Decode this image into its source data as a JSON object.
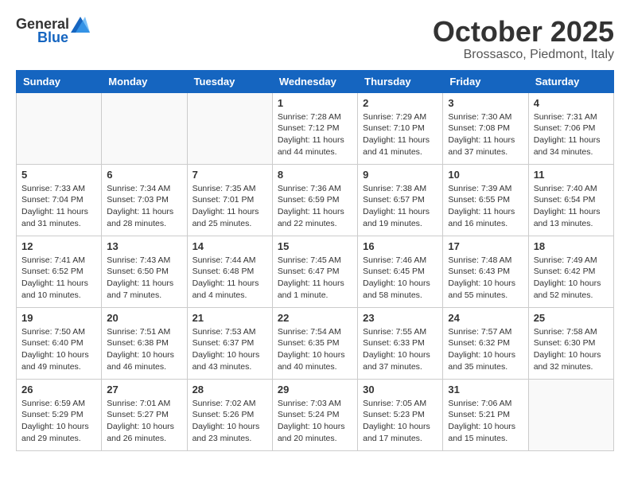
{
  "header": {
    "logo_general": "General",
    "logo_blue": "Blue",
    "month_title": "October 2025",
    "location": "Brossasco, Piedmont, Italy"
  },
  "weekdays": [
    "Sunday",
    "Monday",
    "Tuesday",
    "Wednesday",
    "Thursday",
    "Friday",
    "Saturday"
  ],
  "weeks": [
    [
      {
        "day": "",
        "info": ""
      },
      {
        "day": "",
        "info": ""
      },
      {
        "day": "",
        "info": ""
      },
      {
        "day": "1",
        "info": "Sunrise: 7:28 AM\nSunset: 7:12 PM\nDaylight: 11 hours and 44 minutes."
      },
      {
        "day": "2",
        "info": "Sunrise: 7:29 AM\nSunset: 7:10 PM\nDaylight: 11 hours and 41 minutes."
      },
      {
        "day": "3",
        "info": "Sunrise: 7:30 AM\nSunset: 7:08 PM\nDaylight: 11 hours and 37 minutes."
      },
      {
        "day": "4",
        "info": "Sunrise: 7:31 AM\nSunset: 7:06 PM\nDaylight: 11 hours and 34 minutes."
      }
    ],
    [
      {
        "day": "5",
        "info": "Sunrise: 7:33 AM\nSunset: 7:04 PM\nDaylight: 11 hours and 31 minutes."
      },
      {
        "day": "6",
        "info": "Sunrise: 7:34 AM\nSunset: 7:03 PM\nDaylight: 11 hours and 28 minutes."
      },
      {
        "day": "7",
        "info": "Sunrise: 7:35 AM\nSunset: 7:01 PM\nDaylight: 11 hours and 25 minutes."
      },
      {
        "day": "8",
        "info": "Sunrise: 7:36 AM\nSunset: 6:59 PM\nDaylight: 11 hours and 22 minutes."
      },
      {
        "day": "9",
        "info": "Sunrise: 7:38 AM\nSunset: 6:57 PM\nDaylight: 11 hours and 19 minutes."
      },
      {
        "day": "10",
        "info": "Sunrise: 7:39 AM\nSunset: 6:55 PM\nDaylight: 11 hours and 16 minutes."
      },
      {
        "day": "11",
        "info": "Sunrise: 7:40 AM\nSunset: 6:54 PM\nDaylight: 11 hours and 13 minutes."
      }
    ],
    [
      {
        "day": "12",
        "info": "Sunrise: 7:41 AM\nSunset: 6:52 PM\nDaylight: 11 hours and 10 minutes."
      },
      {
        "day": "13",
        "info": "Sunrise: 7:43 AM\nSunset: 6:50 PM\nDaylight: 11 hours and 7 minutes."
      },
      {
        "day": "14",
        "info": "Sunrise: 7:44 AM\nSunset: 6:48 PM\nDaylight: 11 hours and 4 minutes."
      },
      {
        "day": "15",
        "info": "Sunrise: 7:45 AM\nSunset: 6:47 PM\nDaylight: 11 hours and 1 minute."
      },
      {
        "day": "16",
        "info": "Sunrise: 7:46 AM\nSunset: 6:45 PM\nDaylight: 10 hours and 58 minutes."
      },
      {
        "day": "17",
        "info": "Sunrise: 7:48 AM\nSunset: 6:43 PM\nDaylight: 10 hours and 55 minutes."
      },
      {
        "day": "18",
        "info": "Sunrise: 7:49 AM\nSunset: 6:42 PM\nDaylight: 10 hours and 52 minutes."
      }
    ],
    [
      {
        "day": "19",
        "info": "Sunrise: 7:50 AM\nSunset: 6:40 PM\nDaylight: 10 hours and 49 minutes."
      },
      {
        "day": "20",
        "info": "Sunrise: 7:51 AM\nSunset: 6:38 PM\nDaylight: 10 hours and 46 minutes."
      },
      {
        "day": "21",
        "info": "Sunrise: 7:53 AM\nSunset: 6:37 PM\nDaylight: 10 hours and 43 minutes."
      },
      {
        "day": "22",
        "info": "Sunrise: 7:54 AM\nSunset: 6:35 PM\nDaylight: 10 hours and 40 minutes."
      },
      {
        "day": "23",
        "info": "Sunrise: 7:55 AM\nSunset: 6:33 PM\nDaylight: 10 hours and 37 minutes."
      },
      {
        "day": "24",
        "info": "Sunrise: 7:57 AM\nSunset: 6:32 PM\nDaylight: 10 hours and 35 minutes."
      },
      {
        "day": "25",
        "info": "Sunrise: 7:58 AM\nSunset: 6:30 PM\nDaylight: 10 hours and 32 minutes."
      }
    ],
    [
      {
        "day": "26",
        "info": "Sunrise: 6:59 AM\nSunset: 5:29 PM\nDaylight: 10 hours and 29 minutes."
      },
      {
        "day": "27",
        "info": "Sunrise: 7:01 AM\nSunset: 5:27 PM\nDaylight: 10 hours and 26 minutes."
      },
      {
        "day": "28",
        "info": "Sunrise: 7:02 AM\nSunset: 5:26 PM\nDaylight: 10 hours and 23 minutes."
      },
      {
        "day": "29",
        "info": "Sunrise: 7:03 AM\nSunset: 5:24 PM\nDaylight: 10 hours and 20 minutes."
      },
      {
        "day": "30",
        "info": "Sunrise: 7:05 AM\nSunset: 5:23 PM\nDaylight: 10 hours and 17 minutes."
      },
      {
        "day": "31",
        "info": "Sunrise: 7:06 AM\nSunset: 5:21 PM\nDaylight: 10 hours and 15 minutes."
      },
      {
        "day": "",
        "info": ""
      }
    ]
  ]
}
